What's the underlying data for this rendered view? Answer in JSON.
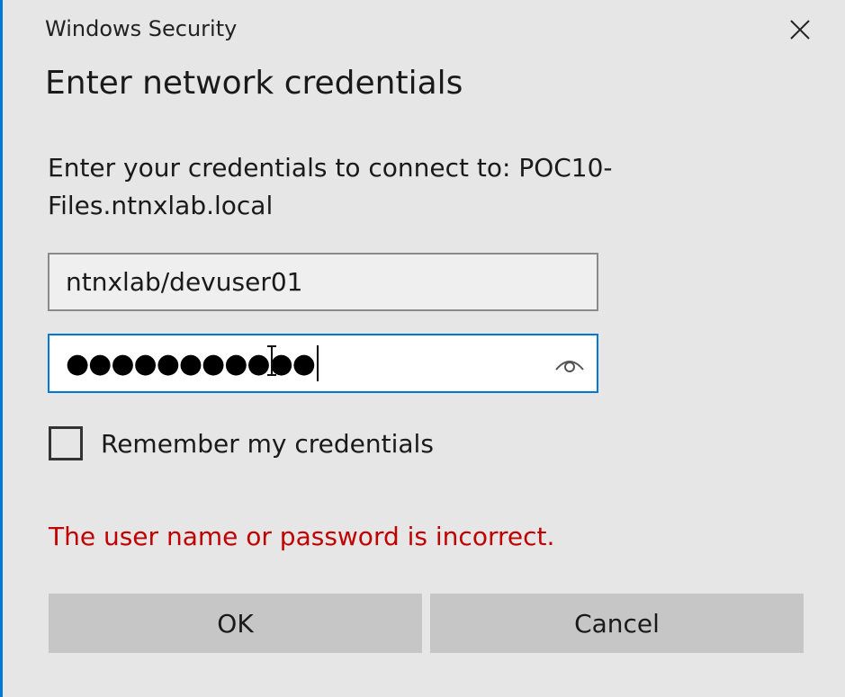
{
  "window": {
    "title": "Windows Security",
    "close_icon": "close-icon"
  },
  "dialog": {
    "heading": "Enter network credentials",
    "message_line1": "Enter your credentials to connect to: POC10-",
    "message_line2": "Files.ntnxlab.local"
  },
  "username": {
    "value": "ntnxlab/devuser01"
  },
  "password": {
    "masked_value": "●●●●●●●●●●●",
    "reveal_icon": "eye-icon"
  },
  "remember": {
    "label": "Remember my credentials",
    "checked": false
  },
  "error": {
    "text": "The user name or password is incorrect.",
    "color": "#c00000"
  },
  "buttons": {
    "ok_label": "OK",
    "cancel_label": "Cancel"
  },
  "colors": {
    "accent": "#0078d7",
    "background": "#e6e6e6",
    "button": "#c6c6c6"
  }
}
